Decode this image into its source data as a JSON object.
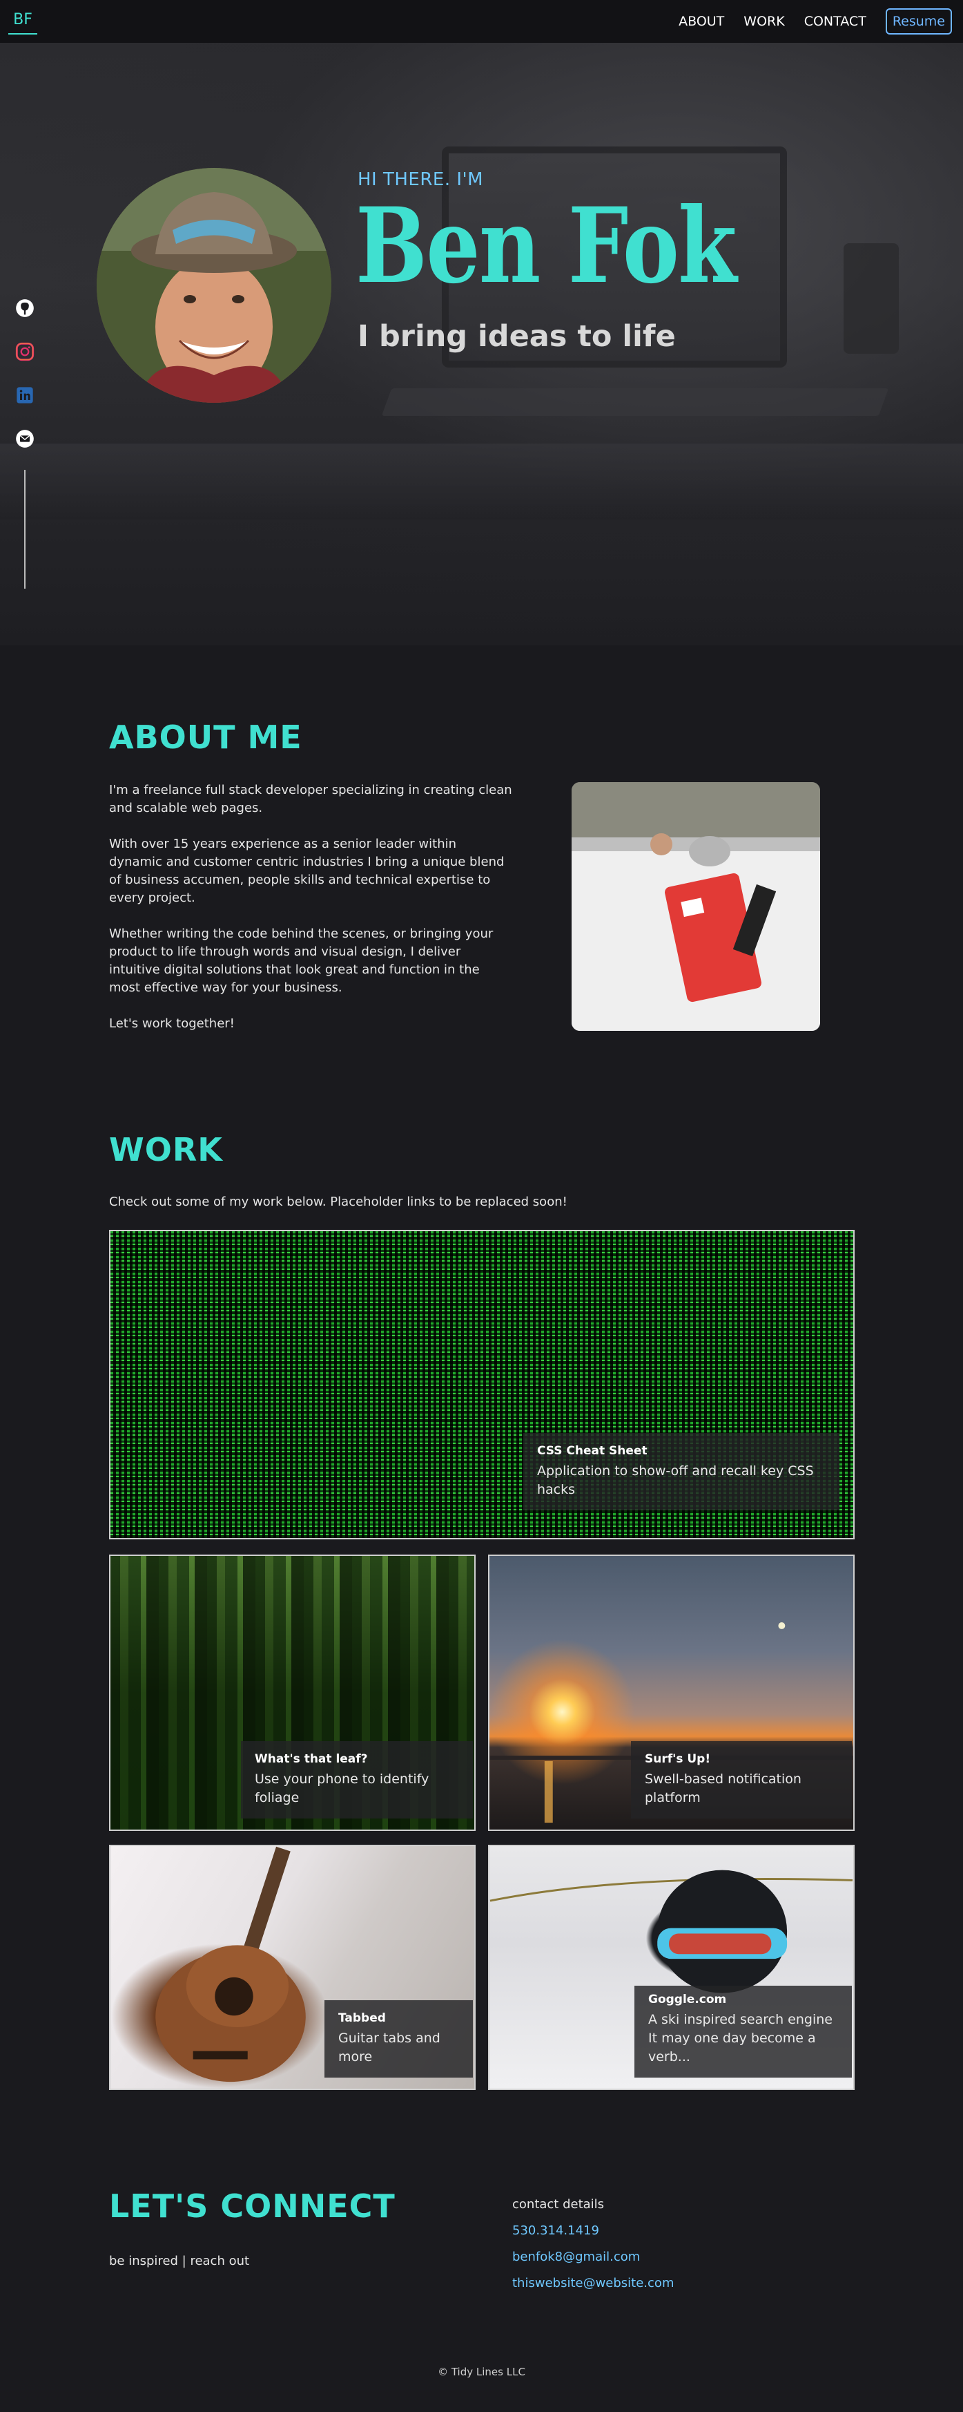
{
  "nav": {
    "logo": "BF",
    "links": [
      "ABOUT",
      "WORK",
      "CONTACT"
    ],
    "resume_label": "Resume"
  },
  "hero": {
    "greeting": "HI THERE. I'M",
    "name": "Ben Fok",
    "tagline": "I bring ideas to life"
  },
  "social": {
    "icons": [
      "github-icon",
      "instagram-icon",
      "linkedin-icon",
      "email-icon"
    ],
    "colors": {
      "github": "#ffffff",
      "instagram": "#e1306c",
      "linkedin": "#2867b2",
      "email": "#ffffff"
    }
  },
  "about": {
    "title": "ABOUT ME",
    "paragraphs": [
      "I'm a freelance full stack developer specializing in creating clean and scalable web pages.",
      "With over 15 years experience as a senior leader within dynamic and customer centric industries I bring a unique blend of business accumen, people skills and technical expertise to every project.",
      "Whether writing the code behind the scenes, or bringing your product to life through words and visual design, I deliver intuitive digital solutions that look great and function in the most effective way for your business.",
      "Let's work together!"
    ]
  },
  "work": {
    "title": "WORK",
    "intro": "Check out some of my work below. Placeholder links to be replaced soon!",
    "projects": [
      {
        "title": "CSS Cheat Sheet",
        "desc": "Application to show-off and recall key CSS hacks"
      },
      {
        "title": "What's that leaf?",
        "desc": "Use your phone to identify foliage"
      },
      {
        "title": "Surf's Up!",
        "desc": "Swell-based notification platform"
      },
      {
        "title": "Tabbed",
        "desc": "Guitar tabs and more"
      },
      {
        "title": "Goggle.com",
        "desc": "A ski inspired search engine",
        "desc2": "It may one day become a verb..."
      }
    ]
  },
  "connect": {
    "title": "LET'S CONNECT",
    "subtitle": "be inspired | reach out",
    "details_label": "contact details",
    "phone": "530.314.1419",
    "email": "benfok8@gmail.com",
    "website": "thiswebsite@website.com"
  },
  "footer": {
    "text": "© Tidy Lines LLC"
  },
  "colors": {
    "accent": "#40e0d0",
    "link": "#6fc8ff",
    "background": "#1a1a1e"
  }
}
